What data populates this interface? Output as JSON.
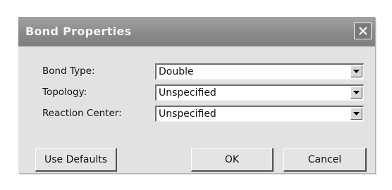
{
  "dialog": {
    "title": "Bond Properties",
    "close_icon": "close-icon"
  },
  "fields": [
    {
      "label": "Bond Type:",
      "value": "Double"
    },
    {
      "label": "Topology:",
      "value": "Unspecified"
    },
    {
      "label": "Reaction Center:",
      "value": "Unspecified"
    }
  ],
  "buttons": {
    "use_defaults": "Use Defaults",
    "ok": "OK",
    "cancel": "Cancel"
  },
  "icons": {
    "dropdown": "chevron-down-icon"
  },
  "colors": {
    "titlebar": "#8a8a8a",
    "dialog_bg": "#e2e2e2"
  }
}
